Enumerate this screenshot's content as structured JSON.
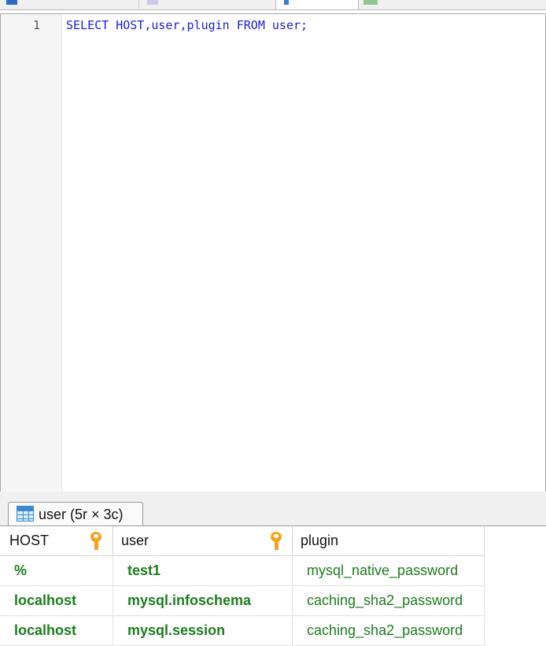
{
  "editor": {
    "line_number": "1",
    "code_line": "SELECT HOST,user,plugin FROM user;"
  },
  "result_tab": {
    "label": "user (5r × 3c)",
    "icon": "table-grid-icon"
  },
  "grid": {
    "columns": [
      {
        "label": "HOST",
        "primary_key": true
      },
      {
        "label": "user",
        "primary_key": true
      },
      {
        "label": "plugin",
        "primary_key": false
      }
    ],
    "rows": [
      {
        "host": "%",
        "user": "test1",
        "plugin": "mysql_native_password"
      },
      {
        "host": "localhost",
        "user": "mysql.infoschema",
        "plugin": "caching_sha2_password"
      },
      {
        "host": "localhost",
        "user": "mysql.session",
        "plugin": "caching_sha2_password"
      }
    ]
  },
  "colors": {
    "keyword_blue": "#1c1ce0",
    "value_green": "#1a7f1a",
    "key_icon": "#f2a31b"
  }
}
